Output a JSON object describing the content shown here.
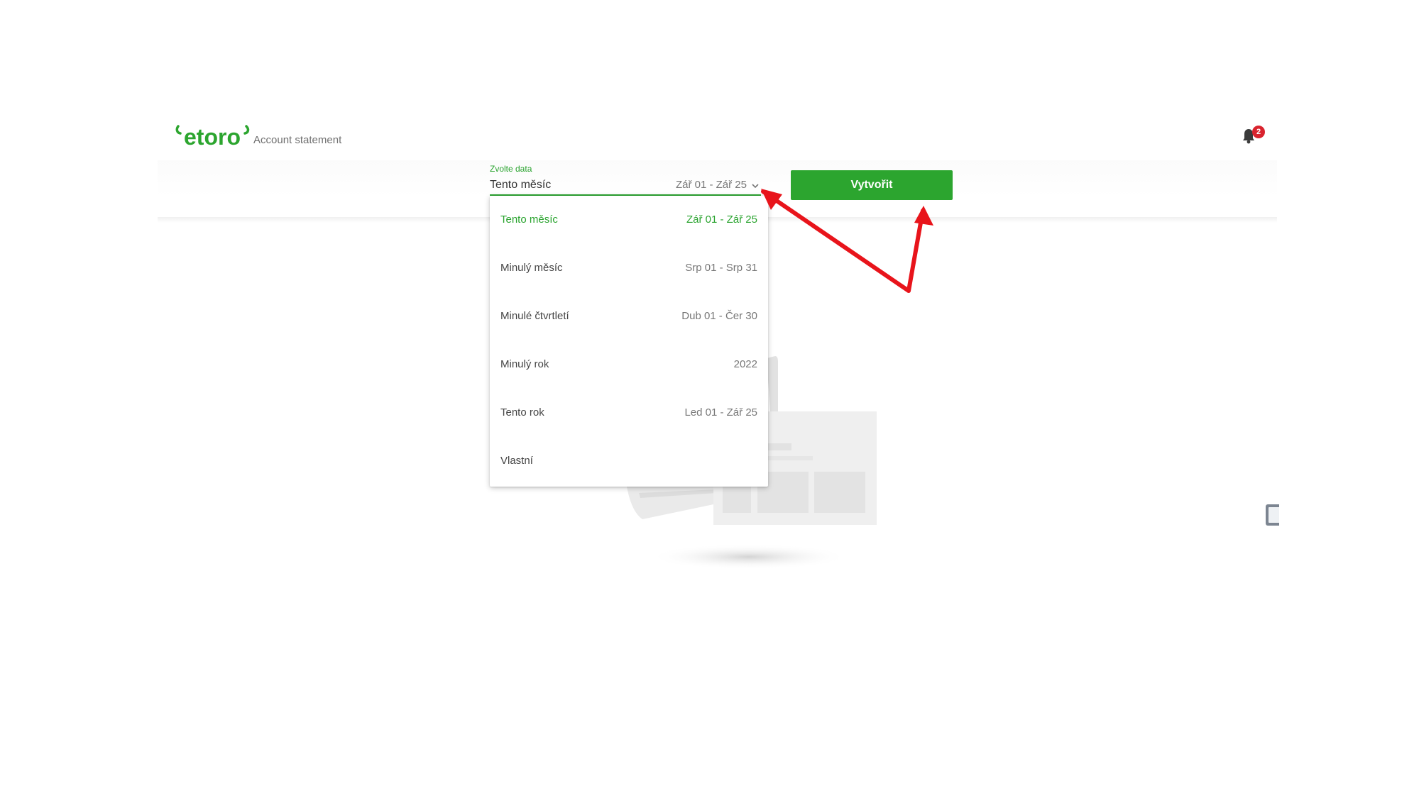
{
  "header": {
    "logo_text": "etoro",
    "subtitle": "Account statement",
    "notifications": {
      "count": "2"
    }
  },
  "date_select": {
    "label": "Zvolte data",
    "value": "Tento měsíc",
    "range": "Zář 01 - Zář 25",
    "is_open": true
  },
  "create_button": {
    "label": "Vytvořit"
  },
  "dropdown": {
    "options": [
      {
        "label": "Tento měsíc",
        "range": "Zář 01 - Zář 25",
        "selected": true
      },
      {
        "label": "Minulý měsíc",
        "range": "Srp 01 - Srp 31",
        "selected": false
      },
      {
        "label": "Minulé čtvrtletí",
        "range": "Dub 01 - Čer 30",
        "selected": false
      },
      {
        "label": "Minulý rok",
        "range": "2022",
        "selected": false
      },
      {
        "label": "Tento rok",
        "range": "Led 01 - Zář 25",
        "selected": false
      },
      {
        "label": "Vlastní",
        "range": "",
        "selected": false
      }
    ]
  },
  "colors": {
    "brand_green": "#2ca52f",
    "badge_red": "#d9232e",
    "annotation_red": "#e8141b"
  }
}
